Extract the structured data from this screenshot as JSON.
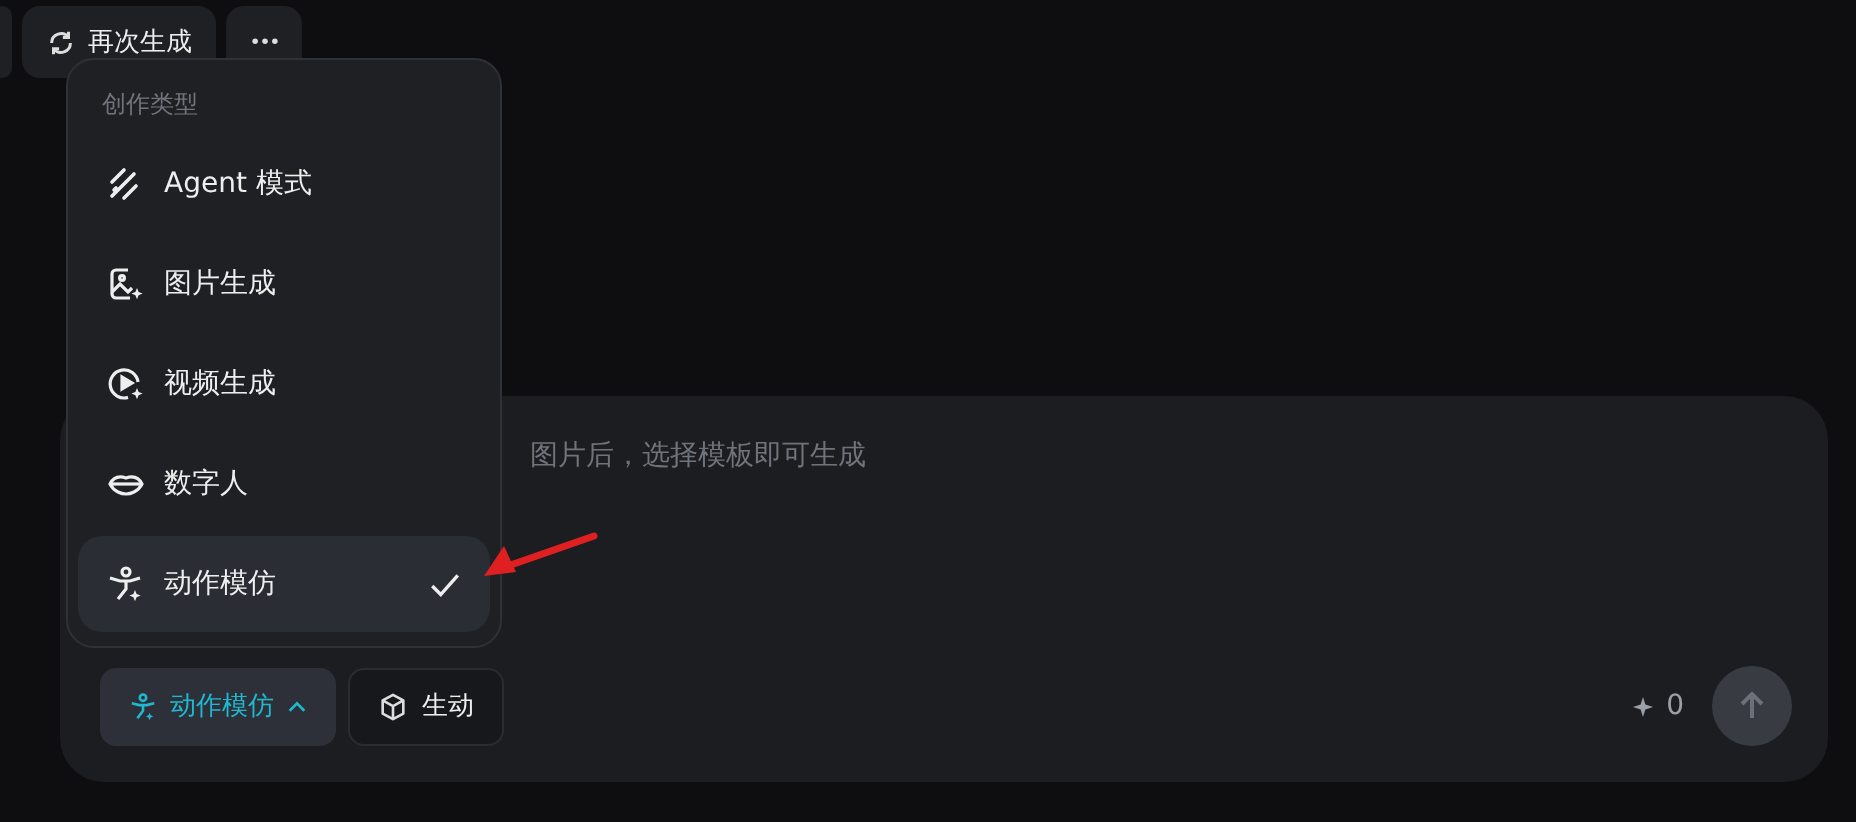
{
  "toolbar": {
    "buttons": [
      {
        "kind": "partial"
      },
      {
        "kind": "regenerate",
        "label": "再次生成"
      },
      {
        "kind": "more"
      }
    ]
  },
  "menu": {
    "header": "创作类型",
    "items": [
      {
        "kind": "agent",
        "label": "Agent 模式",
        "selected": false
      },
      {
        "kind": "image",
        "label": "图片生成",
        "selected": false
      },
      {
        "kind": "video",
        "label": "视频生成",
        "selected": false
      },
      {
        "kind": "avatar",
        "label": "数字人",
        "selected": false
      },
      {
        "kind": "motion",
        "label": "动作模仿",
        "selected": true
      }
    ]
  },
  "composer": {
    "placeholder": "图片后，选择模板即可生成",
    "mode_button": {
      "kind": "motion",
      "label": "动作模仿",
      "expanded": true
    },
    "style_button": {
      "label": "生动"
    },
    "credits": "0"
  }
}
